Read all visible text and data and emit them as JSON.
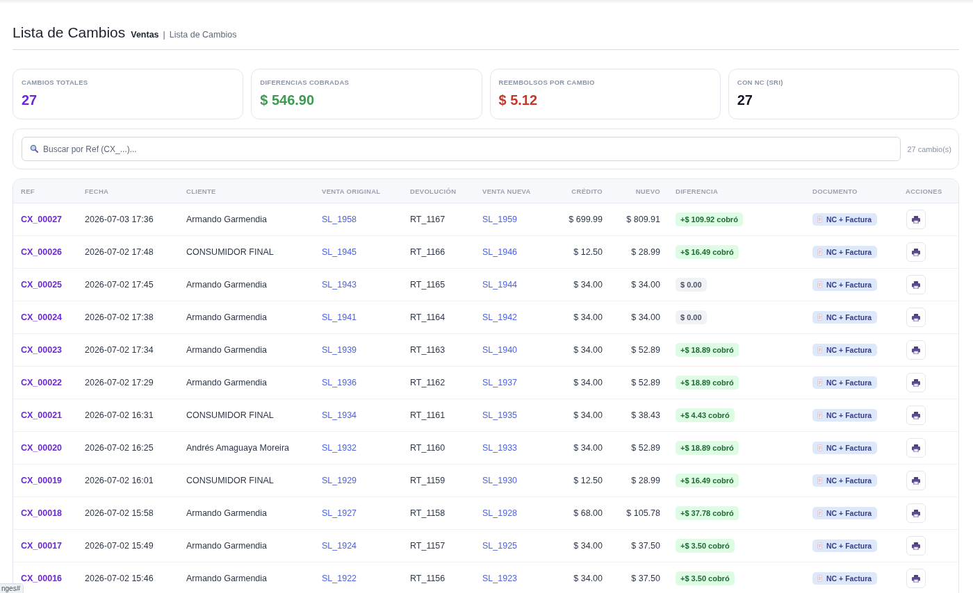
{
  "page": {
    "title": "Lista de Cambios",
    "breadcrumb": [
      {
        "label": "Ventas",
        "current": false
      },
      {
        "label": "Lista de Cambios",
        "current": true
      }
    ],
    "breadcrumb_separator": "|"
  },
  "stats": [
    {
      "label": "CAMBIOS TOTALES",
      "value": "27",
      "color": "#6d28d9"
    },
    {
      "label": "DIFERENCIAS COBRADAS",
      "value": "$ 546.90",
      "color": "#3d9a50"
    },
    {
      "label": "REEMBOLSOS POR CAMBIO",
      "value": "$ 5.12",
      "color": "#c8352b"
    },
    {
      "label": "CON NC (SRI)",
      "value": "27",
      "color": "#111827"
    }
  ],
  "search": {
    "placeholder": "Buscar por Ref (CX_...)...",
    "count": "27 cambio(s)"
  },
  "table": {
    "columns": [
      "REF",
      "FECHA",
      "CLIENTE",
      "VENTA ORIGINAL",
      "DEVOLUCIÓN",
      "VENTA NUEVA",
      "CRÉDITO",
      "NUEVO",
      "DIFERENCIA",
      "DOCUMENTO",
      "ACCIONES"
    ],
    "rows": [
      {
        "ref": "CX_00027",
        "fecha": "2026-07-03 17:36",
        "cliente": "Armando Garmendia",
        "venta_original": "SL_1958",
        "devolucion": "RT_1167",
        "venta_nueva": "SL_1959",
        "credito": "$ 699.99",
        "nuevo": "$ 809.91",
        "diferencia": {
          "text": "+$ 109.92 cobró",
          "kind": "charged"
        },
        "documento": "NC + Factura"
      },
      {
        "ref": "CX_00026",
        "fecha": "2026-07-02 17:48",
        "cliente": "CONSUMIDOR FINAL",
        "venta_original": "SL_1945",
        "devolucion": "RT_1166",
        "venta_nueva": "SL_1946",
        "credito": "$ 12.50",
        "nuevo": "$ 28.99",
        "diferencia": {
          "text": "+$ 16.49 cobró",
          "kind": "charged"
        },
        "documento": "NC + Factura"
      },
      {
        "ref": "CX_00025",
        "fecha": "2026-07-02 17:45",
        "cliente": "Armando Garmendia",
        "venta_original": "SL_1943",
        "devolucion": "RT_1165",
        "venta_nueva": "SL_1944",
        "credito": "$ 34.00",
        "nuevo": "$ 34.00",
        "diferencia": {
          "text": "$ 0.00",
          "kind": "even"
        },
        "documento": "NC + Factura"
      },
      {
        "ref": "CX_00024",
        "fecha": "2026-07-02 17:38",
        "cliente": "Armando Garmendia",
        "venta_original": "SL_1941",
        "devolucion": "RT_1164",
        "venta_nueva": "SL_1942",
        "credito": "$ 34.00",
        "nuevo": "$ 34.00",
        "diferencia": {
          "text": "$ 0.00",
          "kind": "even"
        },
        "documento": "NC + Factura"
      },
      {
        "ref": "CX_00023",
        "fecha": "2026-07-02 17:34",
        "cliente": "Armando Garmendia",
        "venta_original": "SL_1939",
        "devolucion": "RT_1163",
        "venta_nueva": "SL_1940",
        "credito": "$ 34.00",
        "nuevo": "$ 52.89",
        "diferencia": {
          "text": "+$ 18.89 cobró",
          "kind": "charged"
        },
        "documento": "NC + Factura"
      },
      {
        "ref": "CX_00022",
        "fecha": "2026-07-02 17:29",
        "cliente": "Armando Garmendia",
        "venta_original": "SL_1936",
        "devolucion": "RT_1162",
        "venta_nueva": "SL_1937",
        "credito": "$ 34.00",
        "nuevo": "$ 52.89",
        "diferencia": {
          "text": "+$ 18.89 cobró",
          "kind": "charged"
        },
        "documento": "NC + Factura"
      },
      {
        "ref": "CX_00021",
        "fecha": "2026-07-02 16:31",
        "cliente": "CONSUMIDOR FINAL",
        "venta_original": "SL_1934",
        "devolucion": "RT_1161",
        "venta_nueva": "SL_1935",
        "credito": "$ 34.00",
        "nuevo": "$ 38.43",
        "diferencia": {
          "text": "+$ 4.43 cobró",
          "kind": "charged"
        },
        "documento": "NC + Factura"
      },
      {
        "ref": "CX_00020",
        "fecha": "2026-07-02 16:25",
        "cliente": "Andrés Amaguaya Moreira",
        "venta_original": "SL_1932",
        "devolucion": "RT_1160",
        "venta_nueva": "SL_1933",
        "credito": "$ 34.00",
        "nuevo": "$ 52.89",
        "diferencia": {
          "text": "+$ 18.89 cobró",
          "kind": "charged"
        },
        "documento": "NC + Factura"
      },
      {
        "ref": "CX_00019",
        "fecha": "2026-07-02 16:01",
        "cliente": "CONSUMIDOR FINAL",
        "venta_original": "SL_1929",
        "devolucion": "RT_1159",
        "venta_nueva": "SL_1930",
        "credito": "$ 12.50",
        "nuevo": "$ 28.99",
        "diferencia": {
          "text": "+$ 16.49 cobró",
          "kind": "charged"
        },
        "documento": "NC + Factura"
      },
      {
        "ref": "CX_00018",
        "fecha": "2026-07-02 15:58",
        "cliente": "Armando Garmendia",
        "venta_original": "SL_1927",
        "devolucion": "RT_1158",
        "venta_nueva": "SL_1928",
        "credito": "$ 68.00",
        "nuevo": "$ 105.78",
        "diferencia": {
          "text": "+$ 37.78 cobró",
          "kind": "charged"
        },
        "documento": "NC + Factura"
      },
      {
        "ref": "CX_00017",
        "fecha": "2026-07-02 15:49",
        "cliente": "Armando Garmendia",
        "venta_original": "SL_1924",
        "devolucion": "RT_1157",
        "venta_nueva": "SL_1925",
        "credito": "$ 34.00",
        "nuevo": "$ 37.50",
        "diferencia": {
          "text": "+$ 3.50 cobró",
          "kind": "charged"
        },
        "documento": "NC + Factura"
      },
      {
        "ref": "CX_00016",
        "fecha": "2026-07-02 15:46",
        "cliente": "Armando Garmendia",
        "venta_original": "SL_1922",
        "devolucion": "RT_1156",
        "venta_nueva": "SL_1923",
        "credito": "$ 34.00",
        "nuevo": "$ 37.50",
        "diferencia": {
          "text": "+$ 3.50 cobró",
          "kind": "charged"
        },
        "documento": "NC + Factura"
      }
    ]
  },
  "status_url": "nges#"
}
